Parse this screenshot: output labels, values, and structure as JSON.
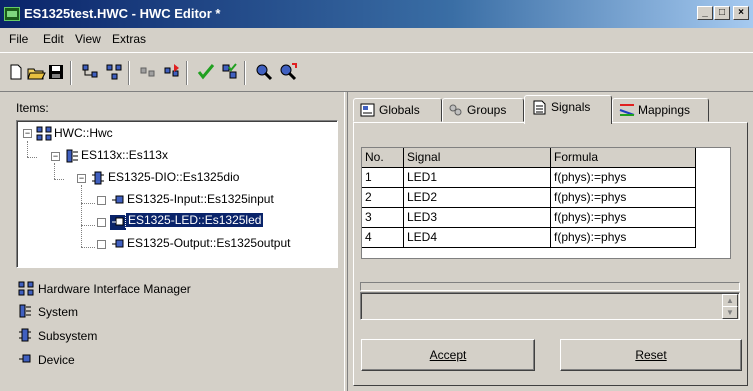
{
  "window": {
    "title": "ES1325test.HWC - HWC Editor  *",
    "minimize_glyph": "_",
    "maximize_glyph": "□",
    "close_glyph": "×"
  },
  "menu": [
    "File",
    "Edit",
    "View",
    "Extras"
  ],
  "toolbar": {
    "icons": [
      "new-icon",
      "open-icon",
      "save-icon",
      "tree-icon",
      "tree-alt-icon",
      "import-icon",
      "export-icon",
      "check-icon",
      "validate-icon",
      "find-icon",
      "find-next-icon"
    ]
  },
  "items_panel": {
    "label": "Items:",
    "tree": [
      {
        "label": "HWC::Hwc",
        "expander": "−"
      },
      {
        "label": "ES113x::Es113x",
        "expander": "−"
      },
      {
        "label": "ES1325-DIO::Es1325dio",
        "expander": "−"
      },
      {
        "label": "ES1325-Input::Es1325input"
      },
      {
        "label": "ES1325-LED::Es1325led",
        "selected": true
      },
      {
        "label": "ES1325-Output::Es1325output"
      }
    ]
  },
  "legend": [
    {
      "icon": "hardware-interface-manager-icon",
      "label": "Hardware Interface Manager"
    },
    {
      "icon": "system-icon",
      "label": "System"
    },
    {
      "icon": "subsystem-icon",
      "label": "Subsystem"
    },
    {
      "icon": "device-icon",
      "label": "Device"
    }
  ],
  "tabs": [
    {
      "label": "Globals",
      "icon": "globals-icon"
    },
    {
      "label": "Groups",
      "icon": "groups-icon"
    },
    {
      "label": "Signals",
      "icon": "signals-icon",
      "active": true
    },
    {
      "label": "Mappings",
      "icon": "mappings-icon"
    }
  ],
  "signals_table": {
    "columns": [
      "No.",
      "Signal",
      "Formula"
    ],
    "rows": [
      [
        "1",
        "LED1",
        "f(phys):=phys"
      ],
      [
        "2",
        "LED2",
        "f(phys):=phys"
      ],
      [
        "3",
        "LED3",
        "f(phys):=phys"
      ],
      [
        "4",
        "LED4",
        "f(phys):=phys"
      ]
    ]
  },
  "formula_input": {
    "value": ""
  },
  "buttons": {
    "accept": "Accept",
    "reset": "Reset"
  },
  "colors": {
    "selection": "#0a246a",
    "titlebar_start": "#0a246a",
    "titlebar_end": "#a6caf0"
  }
}
